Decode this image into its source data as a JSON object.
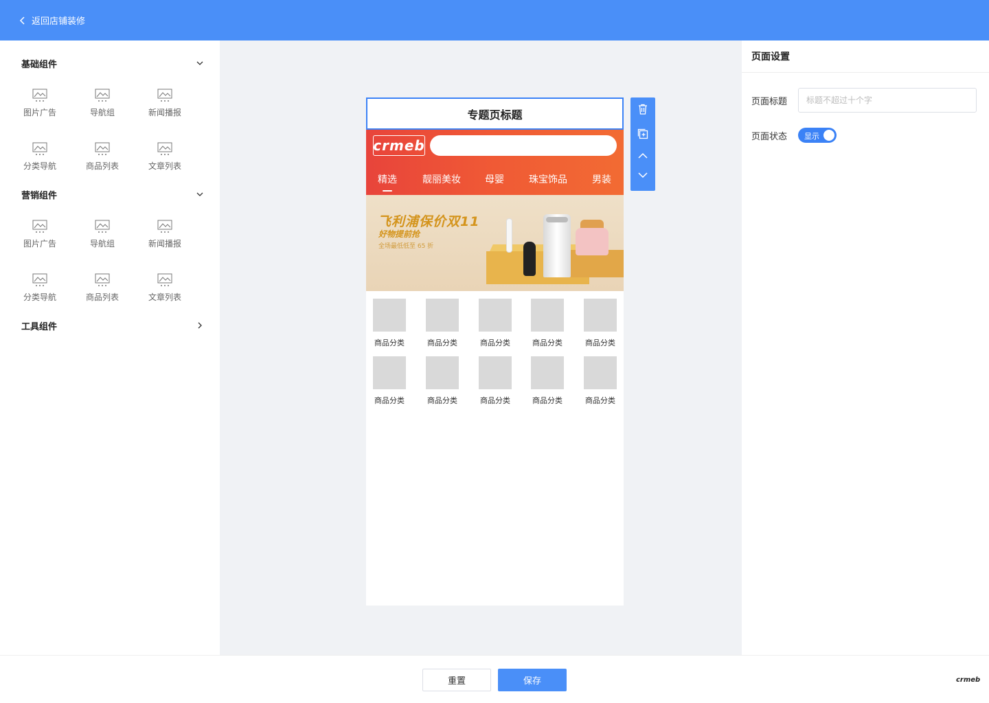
{
  "topbar": {
    "back_label": "返回店铺装修"
  },
  "sidebar": {
    "groups": [
      {
        "title": "基础组件",
        "items": [
          "图片广告",
          "导航组",
          "新闻播报",
          "分类导航",
          "商品列表",
          "文章列表"
        ]
      },
      {
        "title": "营销组件",
        "items": [
          "图片广告",
          "导航组",
          "新闻播报",
          "分类导航",
          "商品列表",
          "文章列表"
        ]
      },
      {
        "title": "工具组件"
      }
    ]
  },
  "preview": {
    "page_title": "专题页标题",
    "logo_text": "crmeb",
    "tabs": [
      "精选",
      "靓丽美妆",
      "母婴",
      "珠宝饰品",
      "男装"
    ],
    "banner": {
      "title": "飞利浦保价双11",
      "subtitle": "好物提前抢",
      "note": "全场最低低至 65 折"
    },
    "categories": [
      "商品分类",
      "商品分类",
      "商品分类",
      "商品分类",
      "商品分类",
      "商品分类",
      "商品分类",
      "商品分类",
      "商品分类",
      "商品分类"
    ]
  },
  "tools": [
    "trash-icon",
    "copy-icon",
    "chevron-up-icon",
    "chevron-down-icon"
  ],
  "settings": {
    "header": "页面设置",
    "title_label": "页面标题",
    "title_placeholder": "标题不超过十个字",
    "status_label": "页面状态",
    "status_value": "显示"
  },
  "footer": {
    "reset_label": "重置",
    "save_label": "保存",
    "logo_text": "crmeb"
  },
  "colors": {
    "primary": "#4a8ff8",
    "header_red": "#e8443b",
    "header_orange": "#f26b33"
  }
}
